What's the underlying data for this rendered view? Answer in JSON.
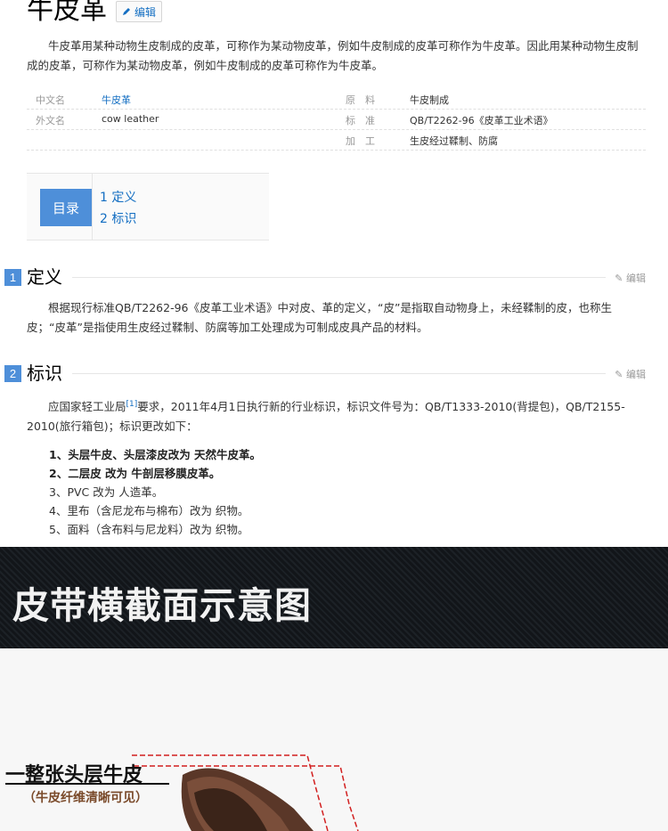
{
  "article": {
    "title": "牛皮革",
    "edit_label": "编辑",
    "summary": "牛皮革用某种动物生皮制成的皮革，可称作为某动物皮革，例如牛皮制成的皮革可称作为牛皮革。因此用某种动物生皮制成的皮革，可称作为某动物皮革，例如牛皮制成的皮革可称作为牛皮革。"
  },
  "infobox": {
    "rows": [
      {
        "k1": "中文名",
        "v1": "牛皮革",
        "k2": "原　料",
        "v2": "牛皮制成"
      },
      {
        "k1": "外文名",
        "v1": "cow leather",
        "k2": "标　准",
        "v2": "QB/T2262-96《皮革工业术语》"
      },
      {
        "k1": "",
        "v1": "",
        "k2": "加　工",
        "v2": "生皮经过鞣制、防腐"
      }
    ]
  },
  "toc": {
    "label": "目录",
    "items": [
      "1  定义",
      "2  标识"
    ]
  },
  "sections": [
    {
      "num": "1",
      "title": "定义",
      "edit": "编辑",
      "text": "根据现行标准QB/T2262-96《皮革工业术语》中对皮、革的定义，“皮”是指取自动物身上，未经鞣制的皮，也称生皮；“皮革”是指使用生皮经过鞣制、防腐等加工处理成为可制成皮具产品的材料。"
    },
    {
      "num": "2",
      "title": "标识",
      "edit": "编辑",
      "text_a": "应国家轻工业局",
      "ref": "[1]",
      "text_b": "要求，2011年4月1日执行新的行业标识，标识文件号为：QB/T1333-2010(背提包)，QB/T2155-2010(旅行箱包)；标识更改如下：",
      "list": [
        "1、头层牛皮、头层漆皮改为 天然牛皮革。",
        "2、二层皮 改为 牛剖层移膜皮革。",
        "3、PVC 改为 人造革。",
        "4、里布（含尼龙布与棉布）改为 织物。",
        "5、面料（含布料与尼龙料）改为 织物。"
      ]
    }
  ],
  "banner": {
    "title": "皮带横截面示意图"
  },
  "diagram": {
    "label_main": "一整张头层牛皮",
    "label_sub": "（牛皮纤维清晰可见）"
  },
  "colors": {
    "accent": "#4e8fd9",
    "link": "#136ec2",
    "banner_bg": "#161a1e"
  }
}
